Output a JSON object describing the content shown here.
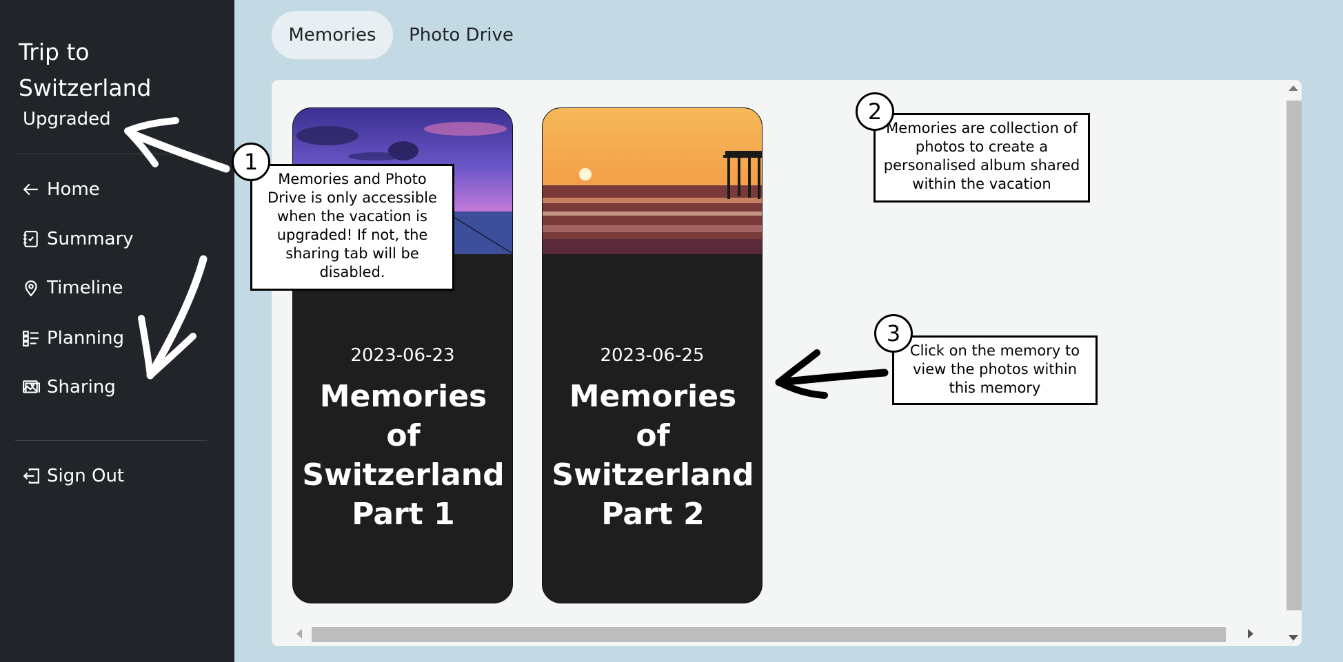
{
  "sidebar": {
    "title": "Trip to Switzerland",
    "badge": "Upgraded",
    "items": [
      {
        "label": "Home",
        "icon": "arrow-left-icon"
      },
      {
        "label": "Summary",
        "icon": "journal-check-icon"
      },
      {
        "label": "Timeline",
        "icon": "geo-pin-icon"
      },
      {
        "label": "Planning",
        "icon": "checklist-icon"
      },
      {
        "label": "Sharing",
        "icon": "images-icon"
      }
    ],
    "sign_out": {
      "label": "Sign Out",
      "icon": "box-arrow-left-icon"
    }
  },
  "tabs": [
    {
      "label": "Memories",
      "active": true
    },
    {
      "label": "Photo Drive",
      "active": false
    }
  ],
  "memories": [
    {
      "date": "2023-06-23",
      "title": "Memories of Switzerland Part 1"
    },
    {
      "date": "2023-06-25",
      "title": "Memories of Switzerland Part 2"
    }
  ],
  "annotations": [
    {
      "number": "1",
      "text": "Memories and Photo Drive is only accessible when the vacation is upgraded! If not, the sharing tab will be disabled."
    },
    {
      "number": "2",
      "text": "Memories are collection of photos to create a personalised album shared within the vacation"
    },
    {
      "number": "3",
      "text": "Click on the memory to view the photos within this memory"
    }
  ],
  "colors": {
    "sidebar_bg": "#212529",
    "page_bg": "#c3d9e3",
    "panel_bg": "#f4f6f6",
    "card_bg": "#1e1e1e"
  }
}
